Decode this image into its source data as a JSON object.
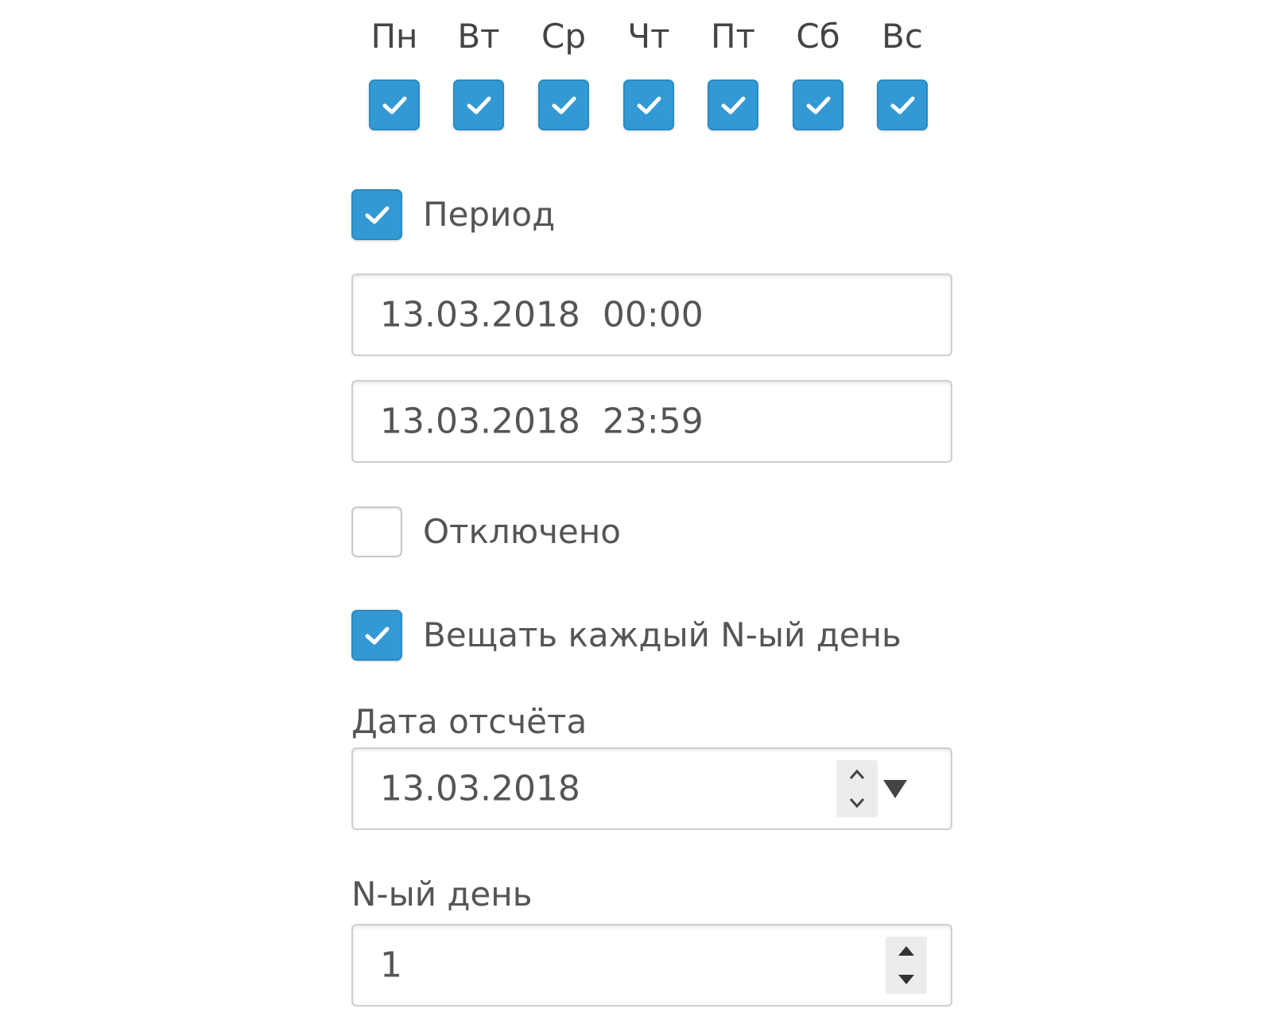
{
  "weekdays": [
    {
      "label": "Пн",
      "checked": true
    },
    {
      "label": "Вт",
      "checked": true
    },
    {
      "label": "Ср",
      "checked": true
    },
    {
      "label": "Чт",
      "checked": true
    },
    {
      "label": "Пт",
      "checked": true
    },
    {
      "label": "Сб",
      "checked": true
    },
    {
      "label": "Вс",
      "checked": true
    }
  ],
  "period": {
    "label": "Период",
    "checked": true,
    "start": "13.03.2018  00:00",
    "end": "13.03.2018  23:59"
  },
  "disabled": {
    "label": "Отключено",
    "checked": false
  },
  "every_nth": {
    "label": "Вещать каждый N-ый день",
    "checked": true
  },
  "start_date": {
    "label": "Дата отсчёта",
    "value": "13.03.2018"
  },
  "nth_day": {
    "label": "N-ый день",
    "value": "1"
  },
  "colors": {
    "accent": "#3399d4",
    "text": "#555555",
    "border": "#cfcfcf"
  },
  "icons": {
    "check": "check-icon",
    "spinner_up": "caret-up-icon",
    "spinner_down": "caret-down-icon",
    "dropdown": "triangle-down-icon"
  }
}
